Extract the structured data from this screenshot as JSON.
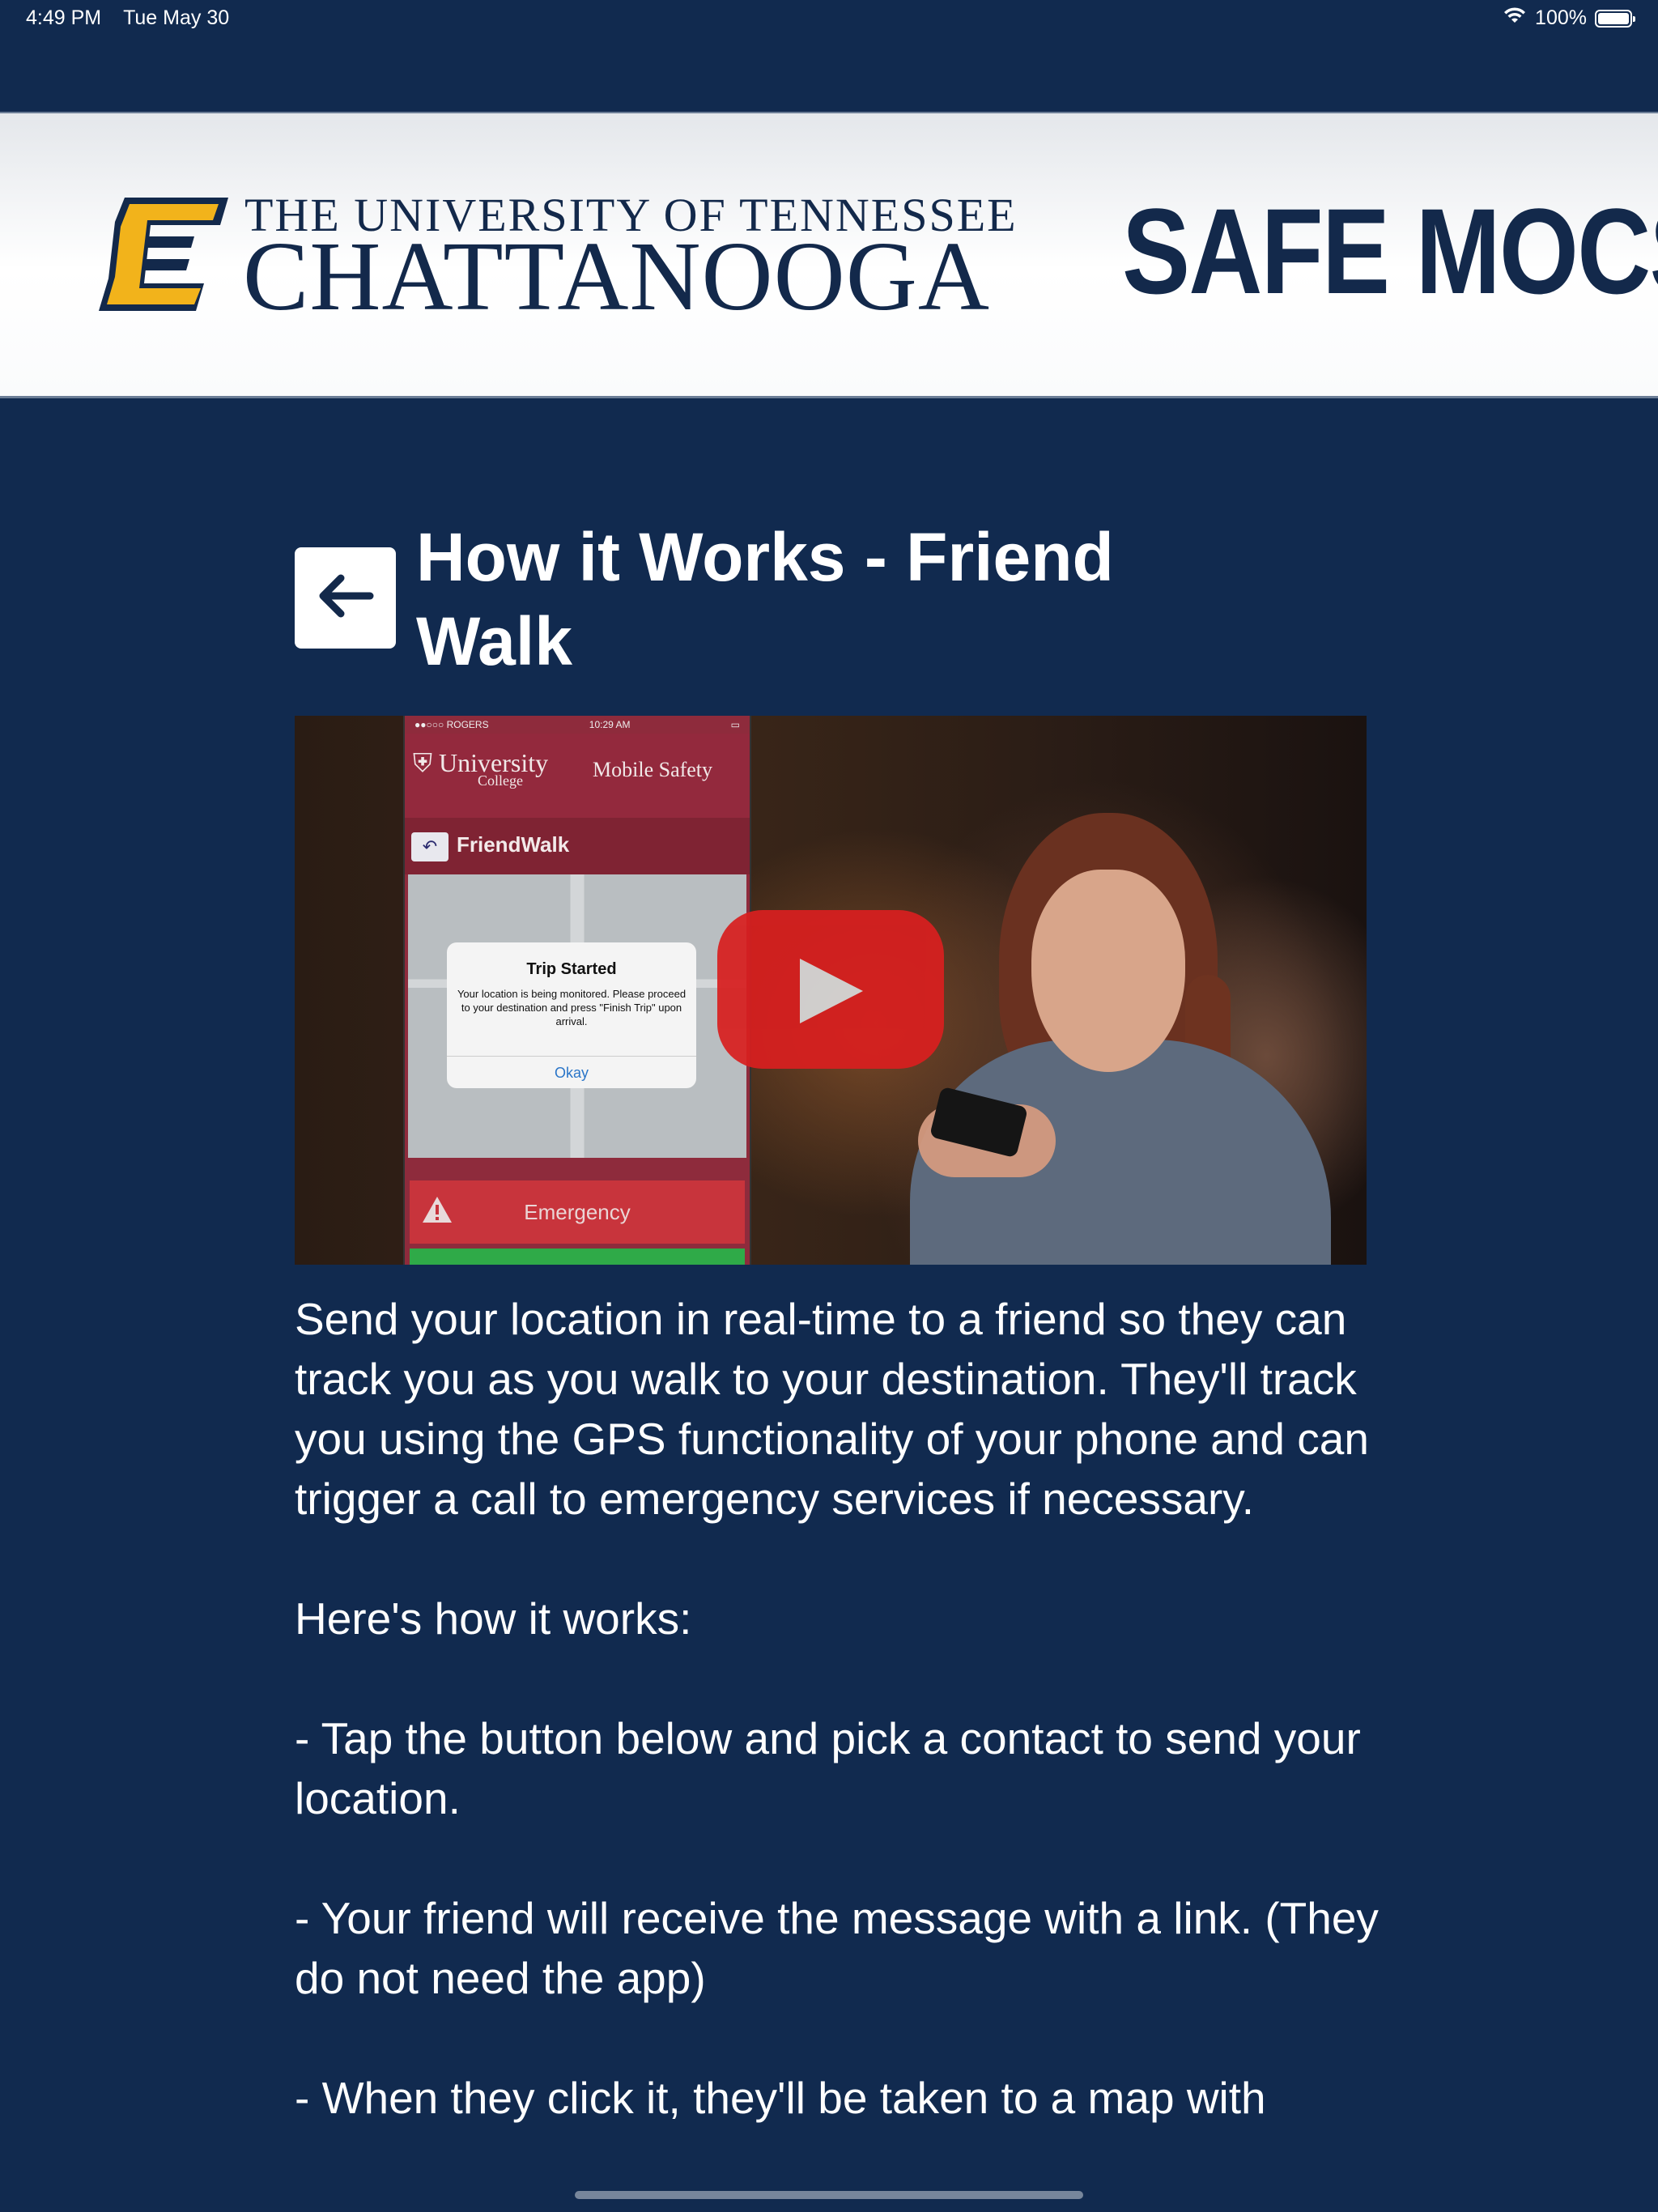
{
  "status_bar": {
    "time": "4:49 PM",
    "date": "Tue May 30",
    "battery": "100%"
  },
  "banner": {
    "university_line1": "THE UNIVERSITY OF TENNESSEE",
    "university_line2": "CHATTANOOGA",
    "logo_letter": "C",
    "app_name": "SAFE MOCS",
    "colors": {
      "navy": "#13294b",
      "gold": "#f2b31b"
    }
  },
  "header": {
    "back_icon": "arrow-left-icon",
    "title": "How it Works - Friend Walk"
  },
  "video": {
    "play_icon": "youtube-play-icon",
    "phone": {
      "carrier": "●●○○○ ROGERS",
      "time": "10:29 AM",
      "brand": "University",
      "brand_sub": "College",
      "mobile_safety": "Mobile Safety",
      "nav_title": "FriendWalk",
      "dialog_title": "Trip Started",
      "dialog_message": "Your location is being monitored. Please proceed to your destination and press \"Finish Trip\" upon arrival.",
      "dialog_button": "Okay",
      "emergency": "Emergency"
    }
  },
  "description": {
    "intro": "Send your location in real-time to a friend so they can track you as you walk to your destination. They'll track you using the GPS functionality of your phone and can trigger a call to emergency services if necessary.",
    "how_heading": "Here's how it works:",
    "step1": "- Tap the button below and pick a contact to send your location.",
    "step2": "- Your friend will receive the message with a link. (They do not need the app)",
    "step3": "- When they click it, they'll be taken to a map with"
  },
  "colors": {
    "background": "#112a4f",
    "text": "#ffffff",
    "play_red": "#d81f1f"
  }
}
